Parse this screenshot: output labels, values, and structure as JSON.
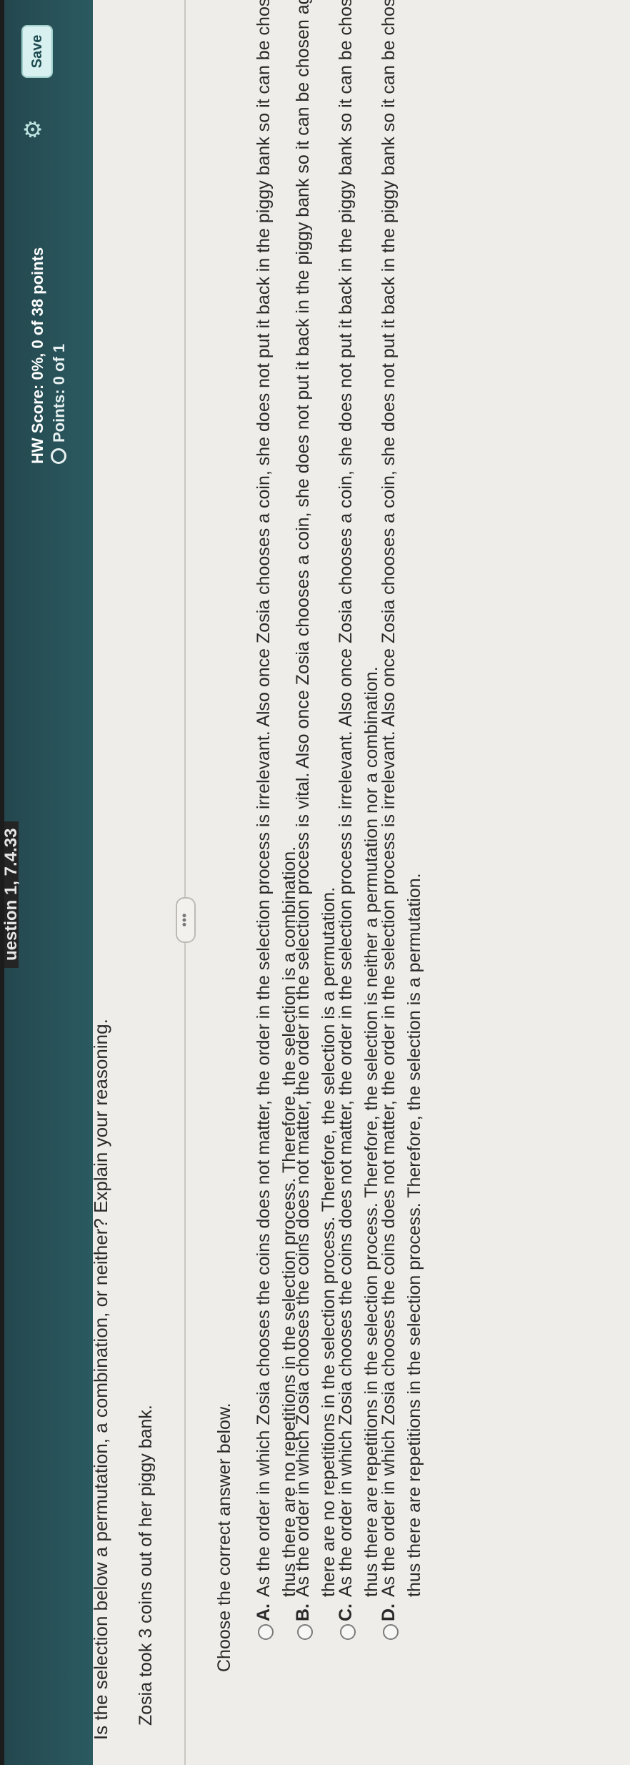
{
  "header": {
    "question_label": "uestion 1, 7.4.33",
    "hw_score": "HW Score: 0%, 0 of 38 points",
    "points": "Points: 0 of 1",
    "save_label": "Save",
    "settings_icon": "gear-icon"
  },
  "question": {
    "prompt": "Is the selection below a permutation, a combination, or neither? Explain your reasoning.",
    "problem": "Zosia took 3 coins out of her piggy bank.",
    "more_button_label": "•••",
    "instruction": "Choose the correct answer below."
  },
  "options": [
    {
      "letter": "A.",
      "line1": "As the order in which Zosia chooses the coins does not matter, the order in the selection process is irrelevant. Also once Zosia chooses a coin, she does not put it back in the piggy bank so it can be chosen again,",
      "line2": "thus there are no repetitions in the selection process. Therefore, the selection is a combination."
    },
    {
      "letter": "B.",
      "line1": "As the order in which Zosia chooses the coins does not matter, the order in the selection process is vital. Also once Zosia chooses a coin, she does not put it back in the piggy bank so it can be chosen again, thus",
      "line2": "there are no repetitions in the selection process. Therefore, the selection is a permutation."
    },
    {
      "letter": "C.",
      "line1": "As the order in which Zosia chooses the coins does not matter, the order in the selection process is irrelevant. Also once Zosia chooses a coin, she does not put it back in the piggy bank so it can be chosen again,",
      "line2": "thus there are repetitions in the selection process. Therefore, the selection is neither a permutation nor a combination."
    },
    {
      "letter": "D.",
      "line1": "As the order in which Zosia chooses the coins does not matter, the order in the selection process is irrelevant. Also once Zosia chooses a coin, she does not put it back in the piggy bank so it can be chosen again,",
      "line2": "thus there are repetitions in the selection process. Therefore, the selection is a permutation."
    }
  ],
  "colors": {
    "header_teal": "#2b5a61",
    "save_button": "#d8f0ef",
    "page_background": "#efede9"
  }
}
